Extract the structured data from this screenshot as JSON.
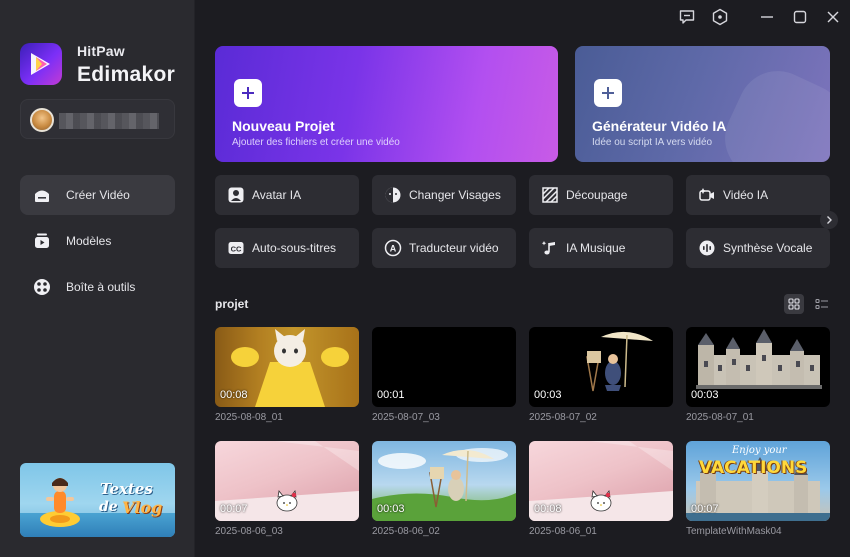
{
  "brand": {
    "top": "HitPaw",
    "main": "Edimakor"
  },
  "nav": [
    {
      "label": "Créer Vidéo",
      "icon": "home-icon",
      "active": true
    },
    {
      "label": "Modèles",
      "icon": "templates-icon",
      "active": false
    },
    {
      "label": "Boîte à outils",
      "icon": "toolbox-icon",
      "active": false
    }
  ],
  "promo": {
    "line1": "Textes",
    "line2a": "de",
    "line2b": "Vlog"
  },
  "hero": [
    {
      "title": "Nouveau Projet",
      "subtitle": "Ajouter des fichiers et créer une vidéo"
    },
    {
      "title": "Générateur Vidéo IA",
      "subtitle": "Idée ou script IA vers vidéo"
    }
  ],
  "tools": [
    {
      "label": "Avatar IA",
      "icon": "avatar-icon"
    },
    {
      "label": "Changer Visages",
      "icon": "face-swap-icon"
    },
    {
      "label": "Découpage",
      "icon": "cutout-icon"
    },
    {
      "label": "Vidéo IA",
      "icon": "ai-video-icon"
    },
    {
      "label": "Auto-sous-titres",
      "icon": "cc-icon"
    },
    {
      "label": "Traducteur vidéo",
      "icon": "translate-icon"
    },
    {
      "label": "IA Musique",
      "icon": "music-icon"
    },
    {
      "label": "Synthèse Vocale",
      "icon": "voice-icon"
    }
  ],
  "projects_title": "projet",
  "projects": [
    {
      "name": "2025-08-08_01",
      "duration": "00:08",
      "thumb": "cat-yellow"
    },
    {
      "name": "2025-08-07_03",
      "duration": "00:01",
      "thumb": "black"
    },
    {
      "name": "2025-08-07_02",
      "duration": "00:03",
      "thumb": "painter-dark"
    },
    {
      "name": "2025-08-07_01",
      "duration": "00:03",
      "thumb": "castle-dark"
    },
    {
      "name": "2025-08-06_03",
      "duration": "00:07",
      "thumb": "hello-kitty"
    },
    {
      "name": "2025-08-06_02",
      "duration": "00:03",
      "thumb": "painter-sky"
    },
    {
      "name": "2025-08-06_01",
      "duration": "00:08",
      "thumb": "hello-kitty"
    },
    {
      "name": "TemplateWithMask04",
      "duration": "00:07",
      "thumb": "vacations"
    }
  ],
  "vacations": {
    "line1": "Enjoy your",
    "line2": "VACATIONS"
  },
  "colors": {
    "accent": "#7b2ff7",
    "sidebar": "#2a2a2f",
    "background": "#1c1c21",
    "tile": "#2d2d33"
  }
}
